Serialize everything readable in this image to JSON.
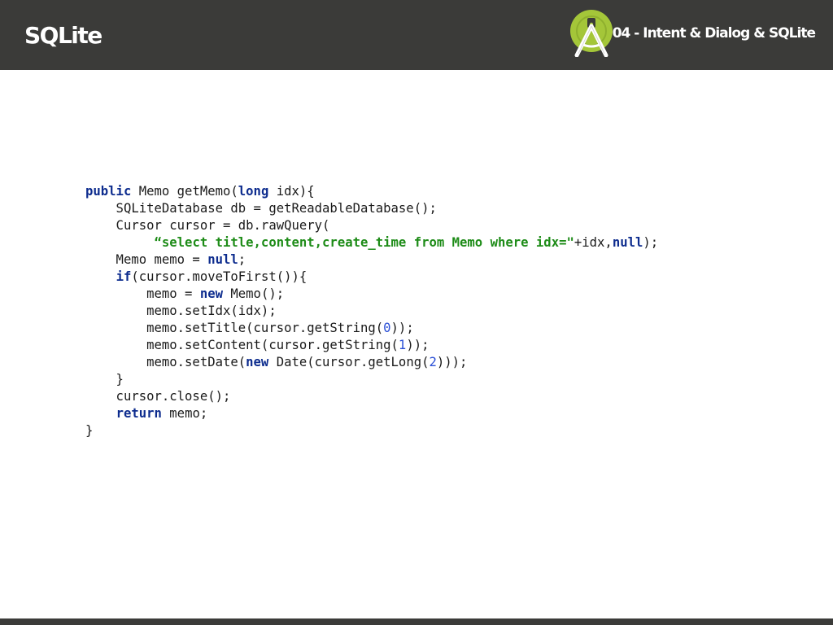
{
  "header": {
    "title": "SQLite",
    "subtitle": "04 - Intent & Dialog & SQLite",
    "logo_icon": "android-studio-icon"
  },
  "colors": {
    "header_bg": "#3b3b39",
    "keyword": "#0d2c8e",
    "string": "#1e8c18",
    "number": "#2a4fd6",
    "text": "#1a1a1a"
  },
  "code": {
    "language": "java",
    "lines": [
      [
        {
          "t": "kw",
          "v": "public"
        },
        {
          "t": "plain",
          "v": " Memo getMemo("
        },
        {
          "t": "kw",
          "v": "long"
        },
        {
          "t": "plain",
          "v": " idx){"
        }
      ],
      [
        {
          "t": "plain",
          "v": "    SQLiteDatabase db = getReadableDatabase();"
        }
      ],
      [
        {
          "t": "plain",
          "v": "    Cursor cursor = db.rawQuery("
        }
      ],
      [
        {
          "t": "plain",
          "v": "         "
        },
        {
          "t": "str",
          "v": "“select title,content,create_time from Memo where idx=\""
        },
        {
          "t": "plain",
          "v": "+idx,"
        },
        {
          "t": "kw",
          "v": "null"
        },
        {
          "t": "plain",
          "v": ");"
        }
      ],
      [
        {
          "t": "plain",
          "v": "    Memo memo = "
        },
        {
          "t": "kw",
          "v": "null"
        },
        {
          "t": "plain",
          "v": ";"
        }
      ],
      [
        {
          "t": "plain",
          "v": "    "
        },
        {
          "t": "kw",
          "v": "if"
        },
        {
          "t": "plain",
          "v": "(cursor.moveToFirst()){"
        }
      ],
      [
        {
          "t": "plain",
          "v": "        memo = "
        },
        {
          "t": "kw",
          "v": "new"
        },
        {
          "t": "plain",
          "v": " Memo();"
        }
      ],
      [
        {
          "t": "plain",
          "v": "        memo.setIdx(idx);"
        }
      ],
      [
        {
          "t": "plain",
          "v": "        memo.setTitle(cursor.getString("
        },
        {
          "t": "num",
          "v": "0"
        },
        {
          "t": "plain",
          "v": "));"
        }
      ],
      [
        {
          "t": "plain",
          "v": "        memo.setContent(cursor.getString("
        },
        {
          "t": "num",
          "v": "1"
        },
        {
          "t": "plain",
          "v": "));"
        }
      ],
      [
        {
          "t": "plain",
          "v": "        memo.setDate("
        },
        {
          "t": "kw",
          "v": "new"
        },
        {
          "t": "plain",
          "v": " Date(cursor.getLong("
        },
        {
          "t": "num",
          "v": "2"
        },
        {
          "t": "plain",
          "v": ")));"
        }
      ],
      [
        {
          "t": "plain",
          "v": "    }"
        }
      ],
      [
        {
          "t": "plain",
          "v": "    cursor.close();"
        }
      ],
      [
        {
          "t": "plain",
          "v": "    "
        },
        {
          "t": "kw",
          "v": "return"
        },
        {
          "t": "plain",
          "v": " memo;"
        }
      ],
      [
        {
          "t": "plain",
          "v": "}"
        }
      ]
    ]
  }
}
